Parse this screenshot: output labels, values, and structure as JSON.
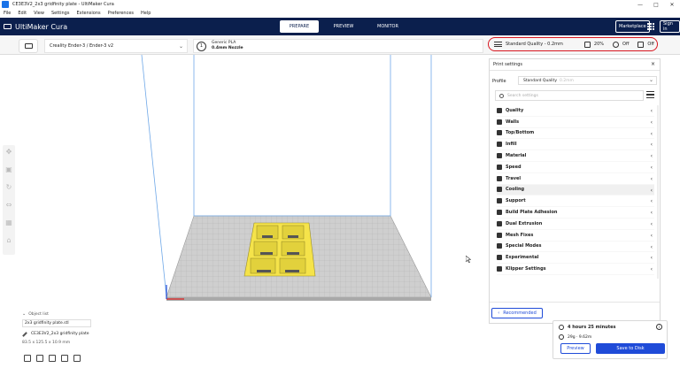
{
  "window": {
    "title": "CE3E3V2_2x3 gridfinity plate - UltiMaker Cura",
    "controls": [
      "—",
      "□",
      "✕"
    ]
  },
  "menu": [
    "File",
    "Edit",
    "View",
    "Settings",
    "Extensions",
    "Preferences",
    "Help"
  ],
  "header": {
    "brand": "UltiMaker Cura",
    "tabs": [
      {
        "label": "PREPARE",
        "active": true
      },
      {
        "label": "PREVIEW",
        "active": false
      },
      {
        "label": "MONITOR",
        "active": false
      }
    ],
    "marketplace": "Marketplace",
    "signin": "Sign in"
  },
  "toolbar": {
    "printer": "Creality Ender-3 / Ender-3 v2",
    "extruder_number": "1",
    "material": "Generic PLA",
    "nozzle": "0.4mm Nozzle"
  },
  "quality_bar": {
    "profile": "Standard Quality - 0.2mm",
    "infill": "20%",
    "support": "Off",
    "adhesion": "Off",
    "highlight_color": "#d8161f"
  },
  "print_settings": {
    "title": "Print settings",
    "close": "×",
    "profile_label": "Profile",
    "profile_value": "Standard Quality",
    "profile_sub": "0.2mm",
    "search_placeholder": "Search settings",
    "categories": [
      {
        "label": "Quality",
        "icon": "quality-icon"
      },
      {
        "label": "Walls",
        "icon": "walls-icon"
      },
      {
        "label": "Top/Bottom",
        "icon": "top-bottom-icon"
      },
      {
        "label": "Infill",
        "icon": "infill-icon"
      },
      {
        "label": "Material",
        "icon": "material-icon"
      },
      {
        "label": "Speed",
        "icon": "speed-icon"
      },
      {
        "label": "Travel",
        "icon": "travel-icon"
      },
      {
        "label": "Cooling",
        "icon": "cooling-icon"
      },
      {
        "label": "Support",
        "icon": "support-icon"
      },
      {
        "label": "Build Plate Adhesion",
        "icon": "adhesion-icon"
      },
      {
        "label": "Dual Extrusion",
        "icon": "dual-extrusion-icon"
      },
      {
        "label": "Mesh Fixes",
        "icon": "mesh-fixes-icon"
      },
      {
        "label": "Special Modes",
        "icon": "special-modes-icon"
      },
      {
        "label": "Experimental",
        "icon": "experimental-icon"
      },
      {
        "label": "Klipper Settings",
        "icon": "klipper-icon"
      }
    ],
    "recommended_button": "Recommended"
  },
  "object_list": {
    "header": "Object list",
    "item": "2x3 gridfinity plate.stl",
    "file_name": "CE3E3V2_2x3 gridfinity plate",
    "dimensions": "83.5 x 125.5 x 10.9 mm"
  },
  "estimate": {
    "time": "4 hours 25 minutes",
    "material": "29g · 9.62m",
    "preview_button": "Preview",
    "save_button": "Save to Disk"
  },
  "colors": {
    "header_bg": "#0b1f4d",
    "accent_blue": "#1f4bd8",
    "model_yellow": "#f5e34a",
    "build_plate": "#c8c8c8",
    "build_volume_line": "#6fa8e8"
  }
}
